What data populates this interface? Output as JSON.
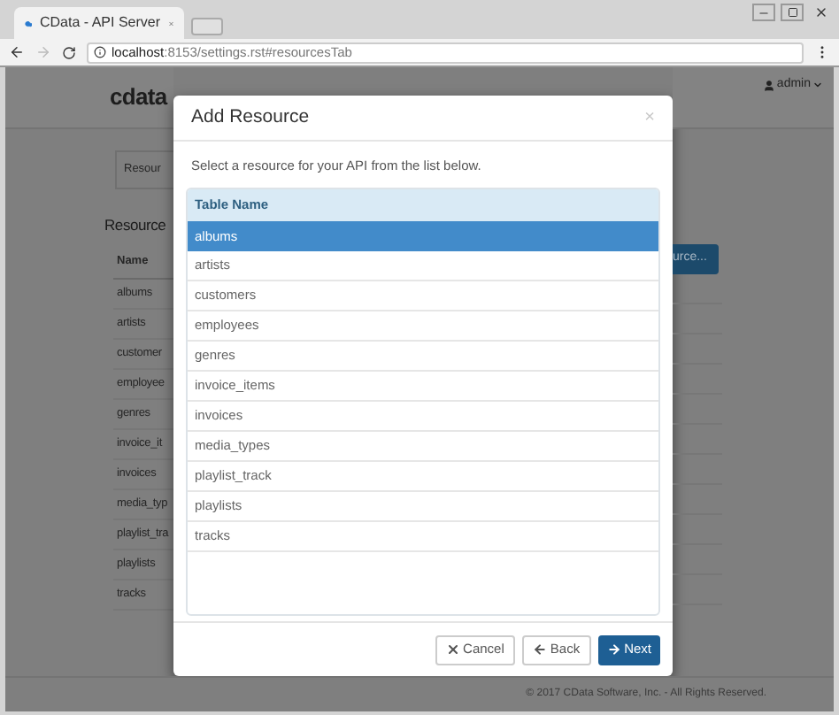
{
  "browser": {
    "tab_title": "CData - API Server",
    "url_host": "localhost",
    "url_path": ":8153/settings.rst#resourcesTab"
  },
  "page": {
    "logo": "cdata",
    "user": "admin",
    "tab": "Resour",
    "heading": "Resource",
    "column": "Name",
    "rows": [
      "albums",
      "artists",
      "customer",
      "employee",
      "genres",
      "invoice_it",
      "invoices",
      "media_typ",
      "playlist_tra",
      "playlists",
      "tracks"
    ],
    "add_button": "urce...",
    "footer": "© 2017 CData Software, Inc. - All Rights Reserved."
  },
  "dialog": {
    "title": "Add Resource",
    "close": "×",
    "instruction": "Select a resource for your API from the list below.",
    "table": {
      "column": "Table Name",
      "rows": [
        {
          "name": "albums",
          "selected": true
        },
        {
          "name": "artists",
          "selected": false
        },
        {
          "name": "customers",
          "selected": false
        },
        {
          "name": "employees",
          "selected": false
        },
        {
          "name": "genres",
          "selected": false
        },
        {
          "name": "invoice_items",
          "selected": false
        },
        {
          "name": "invoices",
          "selected": false
        },
        {
          "name": "media_types",
          "selected": false
        },
        {
          "name": "playlist_track",
          "selected": false
        },
        {
          "name": "playlists",
          "selected": false
        },
        {
          "name": "tracks",
          "selected": false
        }
      ]
    },
    "buttons": [
      {
        "kind": "cancel",
        "label": "Cancel"
      },
      {
        "kind": "back",
        "label": "Back"
      },
      {
        "kind": "next",
        "label": "Next"
      }
    ]
  }
}
